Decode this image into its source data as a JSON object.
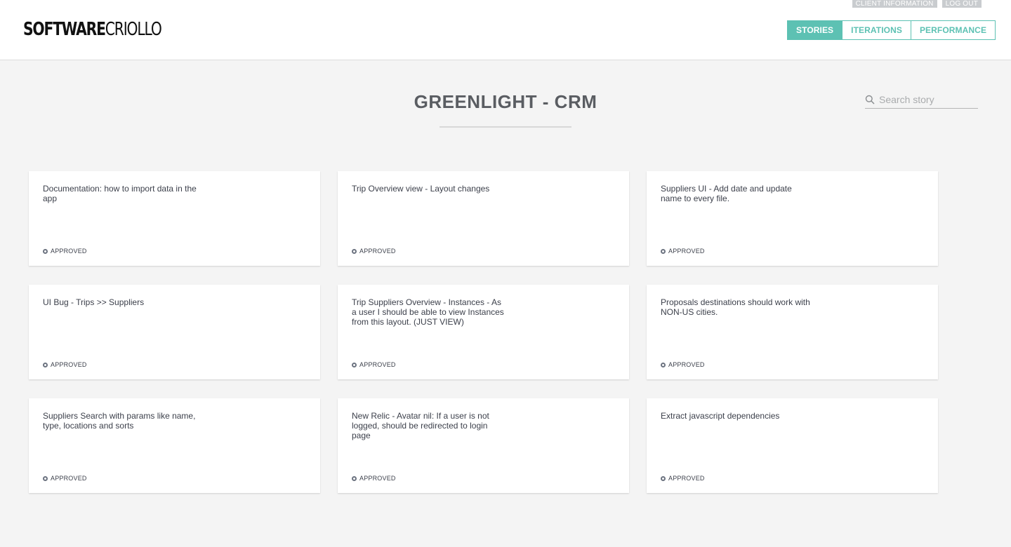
{
  "brand": {
    "logo_bold": "SOFTWARE",
    "logo_light": "CRIOLLO"
  },
  "top_links": {
    "client_information": "CLIENT INFORMATION",
    "log_out": "LOG OUT"
  },
  "nav": {
    "stories": "STORIES",
    "iterations": "ITERATIONS",
    "performance": "PERFORMANCE",
    "active": "STORIES"
  },
  "colors": {
    "accent": "#5dc1b3",
    "background": "#f4f4f4"
  },
  "page": {
    "title": "GREENLIGHT - CRM"
  },
  "search": {
    "placeholder": "Search story",
    "value": "",
    "icon": "search-icon"
  },
  "stories": [
    {
      "title": "Documentation: how to import data in the app",
      "status": "APPROVED"
    },
    {
      "title": "Trip Overview view - Layout changes",
      "status": "APPROVED"
    },
    {
      "title": "Suppliers UI - Add date and update name to every file.",
      "status": "APPROVED"
    },
    {
      "title": "UI Bug - Trips >> Suppliers",
      "status": "APPROVED"
    },
    {
      "title": "Trip Suppliers Overview - Instances - As a user I should be able to view Instances from this layout. (JUST VIEW)",
      "status": "APPROVED"
    },
    {
      "title": "Proposals destinations should work with NON-US cities.",
      "status": "APPROVED"
    },
    {
      "title": "Suppliers Search with params like name, type, locations and sorts",
      "status": "APPROVED"
    },
    {
      "title": "New Relic - Avatar nil: If a user is not logged, should be redirected to login page",
      "status": "APPROVED"
    },
    {
      "title": "Extract javascript dependencies",
      "status": "APPROVED"
    }
  ]
}
